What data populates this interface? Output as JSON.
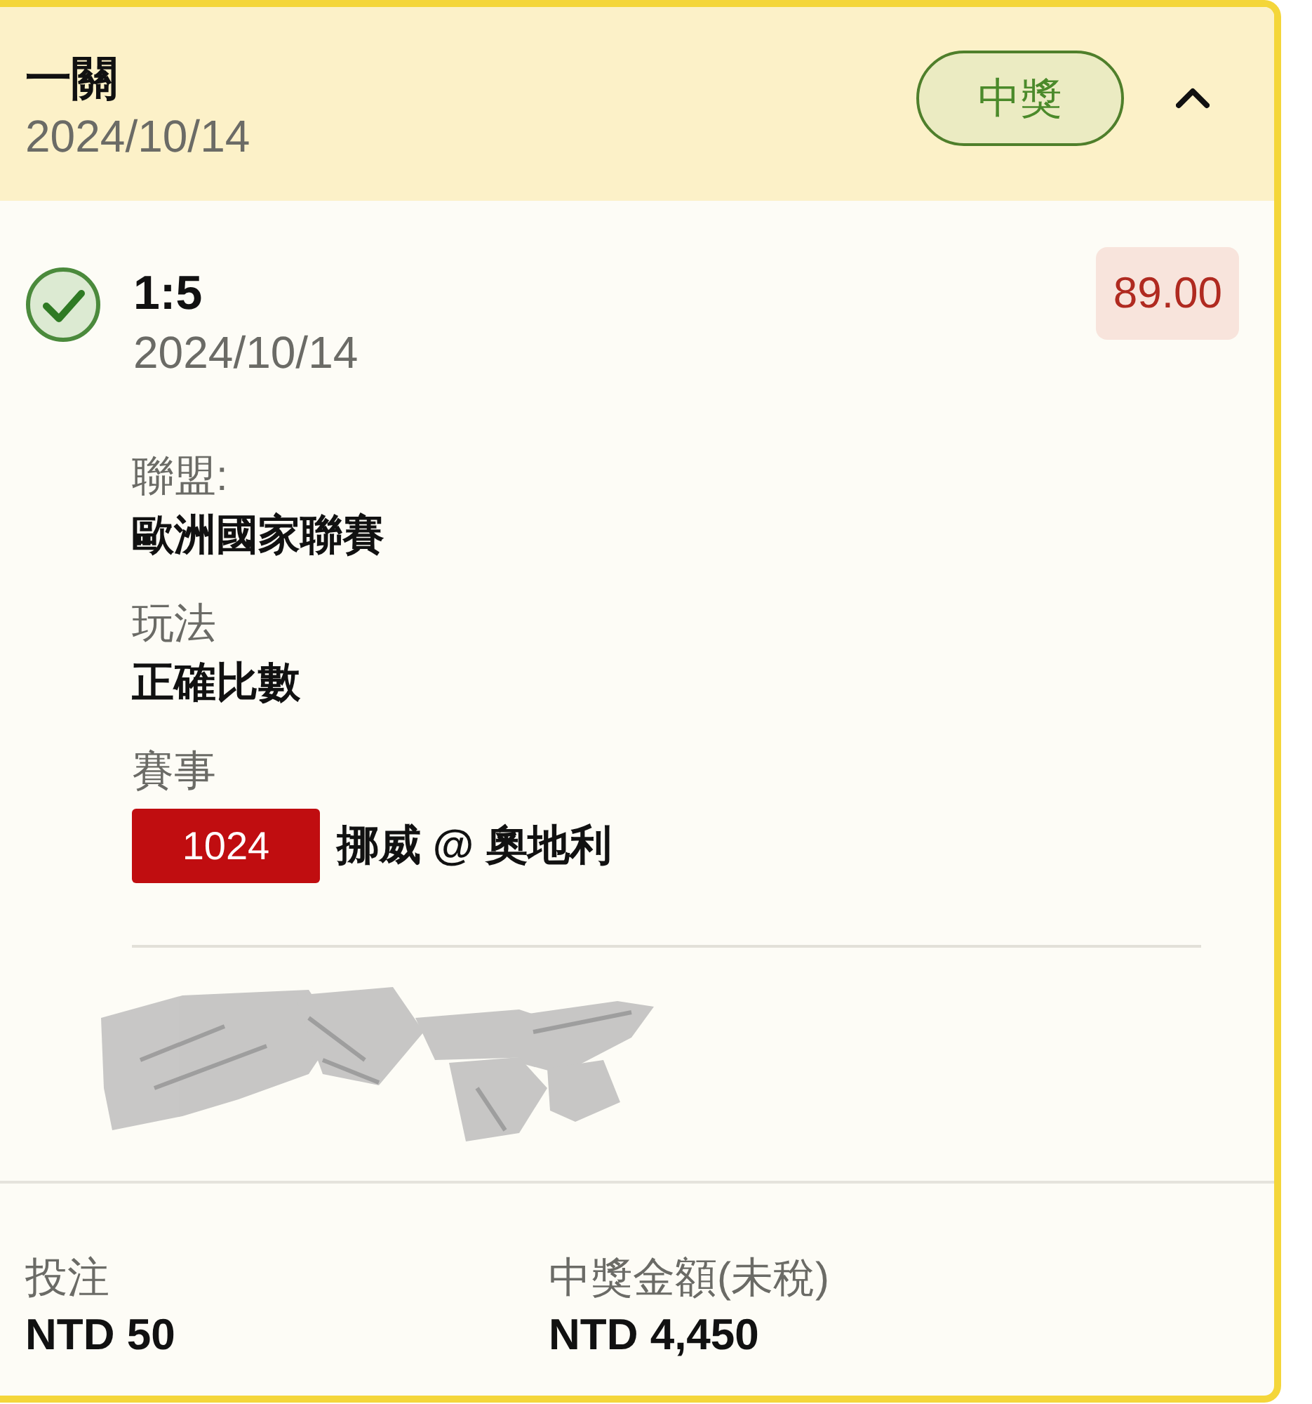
{
  "header": {
    "title": "一關",
    "date": "2024/10/14",
    "status_badge": "中獎",
    "expanded": true
  },
  "selection": {
    "checked": true,
    "score": "1:5",
    "date": "2024/10/14",
    "odds": "89.00"
  },
  "details": [
    {
      "kind": "text",
      "label": "聯盟:",
      "value": "歐洲國家聯賽"
    },
    {
      "kind": "text",
      "label": "玩法",
      "value": "正確比數"
    },
    {
      "kind": "match",
      "label": "賽事",
      "match_code": "1024",
      "value": "挪威 @ 奧地利"
    }
  ],
  "footer": [
    {
      "label": "投注",
      "value": "NTD 50"
    },
    {
      "label": "中獎金額(未稅)",
      "value": "NTD 4,450"
    }
  ]
}
